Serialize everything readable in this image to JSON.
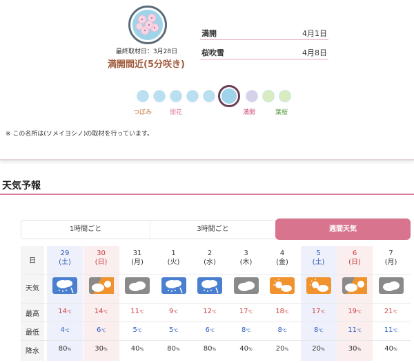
{
  "bloom": {
    "survey_date": "最終取材日：3月28日",
    "status": "満開間近(5分咲き)",
    "info": [
      {
        "label": "満開",
        "date": "4月1日"
      },
      {
        "label": "桜吹雪",
        "date": "4月8日"
      }
    ],
    "stages": [
      {
        "name": "つぼみ",
        "active": false,
        "color": "#b9dff0"
      },
      {
        "name": "",
        "active": false,
        "color": "#b9dff0"
      },
      {
        "name": "開花",
        "active": false,
        "color": "#b9dff0"
      },
      {
        "name": "",
        "active": false,
        "color": "#b9dff0"
      },
      {
        "name": "",
        "active": false,
        "color": "#b9dff0"
      },
      {
        "name": "",
        "active": true,
        "color": "#9fd3ea"
      },
      {
        "name": "満開",
        "active": false,
        "color": "#d7d0ea"
      },
      {
        "name": "",
        "active": false,
        "color": "#d8ecc0"
      },
      {
        "name": "葉桜",
        "active": false,
        "color": "#d8ecc0"
      }
    ],
    "stage_labels": {
      "bud": "つぼみ",
      "flower": "開花",
      "full": "満開",
      "leaf": "葉桜"
    },
    "note": "※ この名所は(ソメイヨシノ)の取材を行っています。"
  },
  "forecast": {
    "title": "天気予報",
    "tabs": [
      {
        "label": "1時間ごと",
        "active": false
      },
      {
        "label": "3時間ごと",
        "active": false
      },
      {
        "label": "週間天気",
        "active": true
      }
    ],
    "row_labels": {
      "date": "日",
      "weather": "天気",
      "high": "最高",
      "low": "最低",
      "rain": "降水"
    },
    "temp_unit": "℃",
    "rain_unit": "%",
    "days": [
      {
        "day": "29",
        "dow": "(土)",
        "kind": "sat",
        "icon": "snow-rain",
        "high": "14",
        "low": "4",
        "rain": "80"
      },
      {
        "day": "30",
        "dow": "(日)",
        "kind": "sun",
        "icon": "cloud-sun",
        "high": "14",
        "low": "6",
        "rain": "30"
      },
      {
        "day": "31",
        "dow": "(月)",
        "kind": "wk",
        "icon": "cloud",
        "high": "11",
        "low": "5",
        "rain": "40"
      },
      {
        "day": "1",
        "dow": "(火)",
        "kind": "wk",
        "icon": "snow-rain",
        "high": "9",
        "low": "5",
        "rain": "80"
      },
      {
        "day": "2",
        "dow": "(水)",
        "kind": "wk",
        "icon": "snow-rain",
        "high": "12",
        "low": "6",
        "rain": "80"
      },
      {
        "day": "3",
        "dow": "(木)",
        "kind": "wk",
        "icon": "cloud",
        "high": "17",
        "low": "8",
        "rain": "40"
      },
      {
        "day": "4",
        "dow": "(金)",
        "kind": "wk",
        "icon": "sun-cloud",
        "high": "18",
        "low": "8",
        "rain": "20"
      },
      {
        "day": "5",
        "dow": "(土)",
        "kind": "sat",
        "icon": "sun-cloud",
        "high": "17",
        "low": "8",
        "rain": "20"
      },
      {
        "day": "6",
        "dow": "(日)",
        "kind": "sun",
        "icon": "cloud-sun",
        "high": "19",
        "low": "11",
        "rain": "30"
      },
      {
        "day": "7",
        "dow": "(月)",
        "kind": "wk",
        "icon": "cloud",
        "high": "21",
        "low": "11",
        "rain": "40"
      }
    ],
    "colors": {
      "accent": "#d9748f",
      "rain_blue": "#4a7fd0",
      "cloud_gray": "#8a8a8a",
      "sun_orange": "#f0922e"
    }
  }
}
